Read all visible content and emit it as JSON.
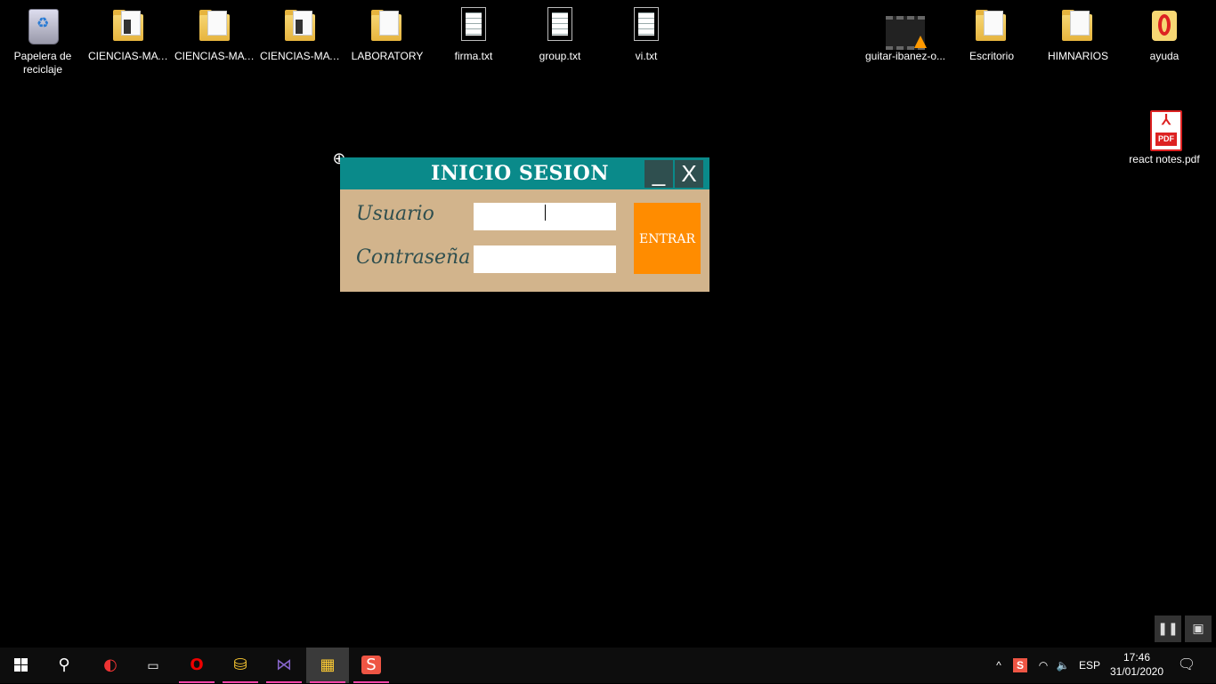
{
  "desktop": {
    "icons": [
      {
        "label": "Papelera de reciclaje",
        "icon": "recycle-bin-icon"
      },
      {
        "label": "CIENCIAS-MAT...",
        "icon": "folder-icon"
      },
      {
        "label": "CIENCIAS-MAT...",
        "icon": "folder-icon"
      },
      {
        "label": "CIENCIAS-MAT...",
        "icon": "folder-icon"
      },
      {
        "label": "LABORATORY",
        "icon": "folder-icon"
      },
      {
        "label": "firma.txt",
        "icon": "text-file-icon"
      },
      {
        "label": "group.txt",
        "icon": "text-file-icon"
      },
      {
        "label": "vi.txt",
        "icon": "text-file-icon"
      },
      {
        "label": "guitar-ibanez-o...",
        "icon": "video-file-icon"
      },
      {
        "label": "Escritorio",
        "icon": "folder-icon"
      },
      {
        "label": "HIMNARIOS",
        "icon": "folder-icon"
      },
      {
        "label": "ayuda",
        "icon": "help-file-icon"
      },
      {
        "label": "react notes.pdf",
        "icon": "pdf-file-icon"
      }
    ]
  },
  "login_window": {
    "title": "INICIO SESION",
    "minimize_label": "_",
    "close_label": "X",
    "username_label": "Usuario",
    "password_label": "Contraseña",
    "username_value": "",
    "password_value": "",
    "enter_label": "ENTRAR"
  },
  "taskbar": {
    "apps": [
      {
        "name": "ccleaner",
        "icon": "ccleaner-icon"
      },
      {
        "name": "terminal",
        "icon": "terminal-icon"
      },
      {
        "name": "opera",
        "icon": "opera-icon"
      },
      {
        "name": "db-tool",
        "icon": "database-icon"
      },
      {
        "name": "visual-studio",
        "icon": "visual-studio-icon"
      },
      {
        "name": "app-active",
        "icon": "app-window-icon"
      },
      {
        "name": "sublime",
        "icon": "sublime-icon"
      }
    ],
    "language": "ESP",
    "time": "17:46",
    "date": "31/01/2020"
  }
}
